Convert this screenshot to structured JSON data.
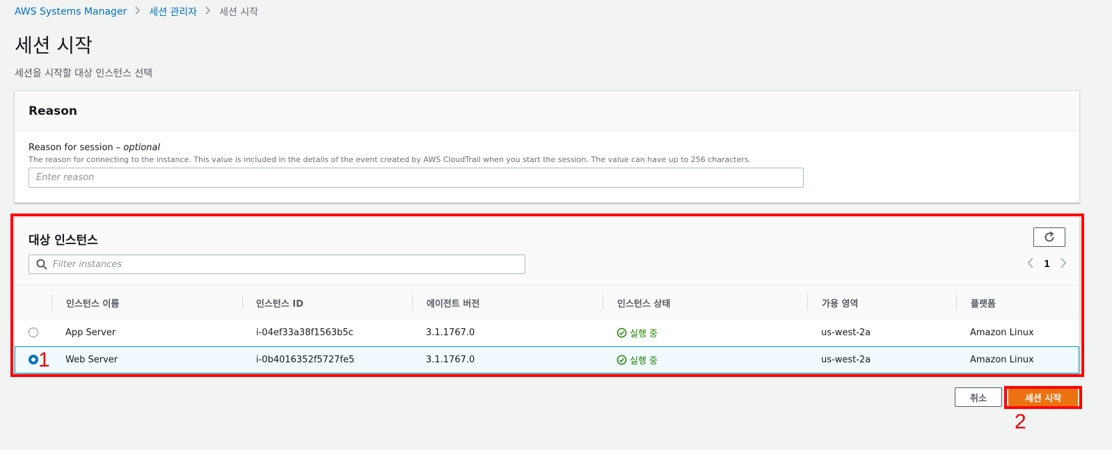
{
  "breadcrumb": {
    "items": [
      "AWS Systems Manager",
      "세션 관리자",
      "세션 시작"
    ]
  },
  "page": {
    "title": "세션 시작",
    "description": "세션을 시작할 대상 인스턴스 선택"
  },
  "reason": {
    "header": "Reason",
    "label": "Reason for session – ",
    "label_optional": "optional",
    "help": "The reason for connecting to the instance. This value is included in the details of the event created by AWS CloudTrail when you start the session. The value can have up to 256 characters.",
    "placeholder": "Enter reason",
    "value": ""
  },
  "instances": {
    "title": "대상 인스턴스",
    "filter_placeholder": "Filter instances",
    "page": "1",
    "columns": [
      "인스턴스 이름",
      "인스턴스 ID",
      "에이전트 버전",
      "인스턴스 상태",
      "가용 영역",
      "플랫폼"
    ],
    "rows": [
      {
        "name": "App Server",
        "id": "i-04ef33a38f1563b5c",
        "agent": "3.1.1767.0",
        "state": "실행 중",
        "az": "us-west-2a",
        "platform": "Amazon Linux",
        "selected": false
      },
      {
        "name": "Web Server",
        "id": "i-0b4016352f5727fe5",
        "agent": "3.1.1767.0",
        "state": "실행 중",
        "az": "us-west-2a",
        "platform": "Amazon Linux",
        "selected": true
      }
    ]
  },
  "actions": {
    "cancel": "취소",
    "start": "세션 시작"
  },
  "annotations": {
    "step1": "1",
    "step2": "2"
  },
  "colors": {
    "primary": "#ec7211",
    "link": "#0073bb",
    "success": "#1d8102",
    "highlight": "#ff0000"
  },
  "icons": [
    "chevron-right-icon",
    "refresh-icon",
    "search-icon",
    "chevron-left-icon",
    "status-success-icon"
  ]
}
